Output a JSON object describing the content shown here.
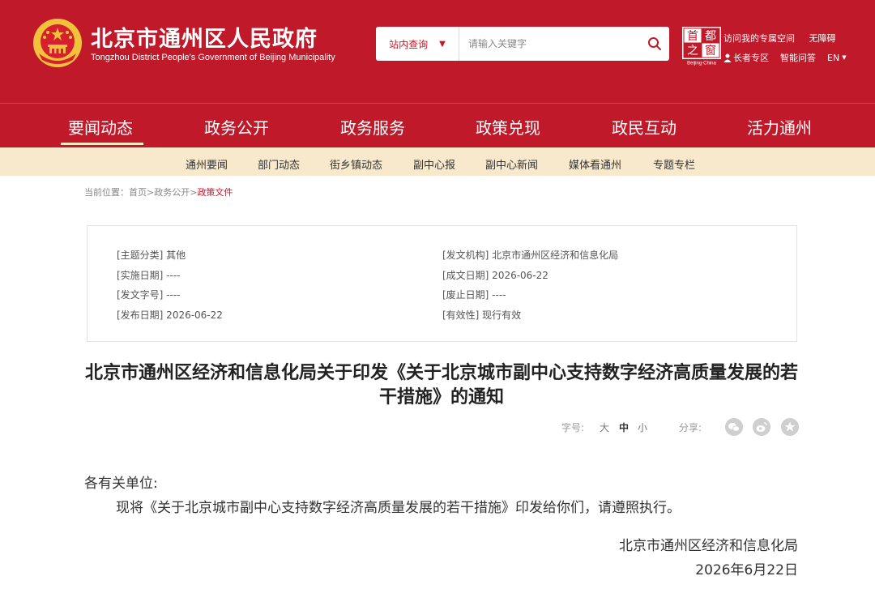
{
  "header": {
    "title": "北京市通州区人民政府",
    "subtitle": "Tongzhou District People's Government of Beijing Municipality",
    "search": {
      "scope": "站内查询",
      "placeholder": "请输入关键字"
    },
    "capital_logo": {
      "chars": [
        "首",
        "都",
        "之",
        "窗"
      ],
      "caption": "Beijing-China"
    },
    "links_row1": [
      "访问我的专属空间",
      "无障碍"
    ],
    "links_row2": [
      "长者专区",
      "智能问答",
      "EN"
    ]
  },
  "main_nav": {
    "items": [
      "要闻动态",
      "政务公开",
      "政务服务",
      "政策兑现",
      "政民互动",
      "活力通州"
    ]
  },
  "sub_nav": {
    "items": [
      "通州要闻",
      "部门动态",
      "街乡镇动态",
      "副中心报",
      "副中心新闻",
      "媒体看通州",
      "专题专栏"
    ]
  },
  "breadcrumb": {
    "prefix": "当前位置：",
    "home": "首页",
    "sep1": ">",
    "level1": "政务公开",
    "sep2": ">",
    "current": "政策文件"
  },
  "meta": {
    "topic": "[主题分类] 其他",
    "effective": "[实施日期] ----",
    "doc_no": "[发文字号] ----",
    "publish": "[发布日期] 2026-06-22",
    "issuer": "[发文机构] 北京市通州区经济和信息化局",
    "created": "[成文日期] 2026-06-22",
    "repeal": "[废止日期] ----",
    "validity": "[有效性] 现行有效"
  },
  "document": {
    "title": "北京市通州区经济和信息化局关于印发《关于北京城市副中心支持数字经济高质量发展的若干措施》的通知",
    "font_label": "字号:",
    "size_large": "大",
    "size_medium": "中",
    "size_small": "小",
    "share_label": "分享:",
    "salutation": "各有关单位:",
    "body": "现将《关于北京城市副中心支持数字经济高质量发展的若干措施》印发给你们，请遵照执行。",
    "signature": "北京市通州区经济和信息化局",
    "date": "2026年6月22日"
  },
  "colors": {
    "brand_red": "#c0192a",
    "subnav_bg": "#f8e9cc",
    "emblem_gold": "#f3c23c"
  },
  "icons": [
    "national-emblem-icon",
    "search-icon",
    "person-icon",
    "wechat-icon",
    "weibo-icon",
    "favorite-icon"
  ]
}
